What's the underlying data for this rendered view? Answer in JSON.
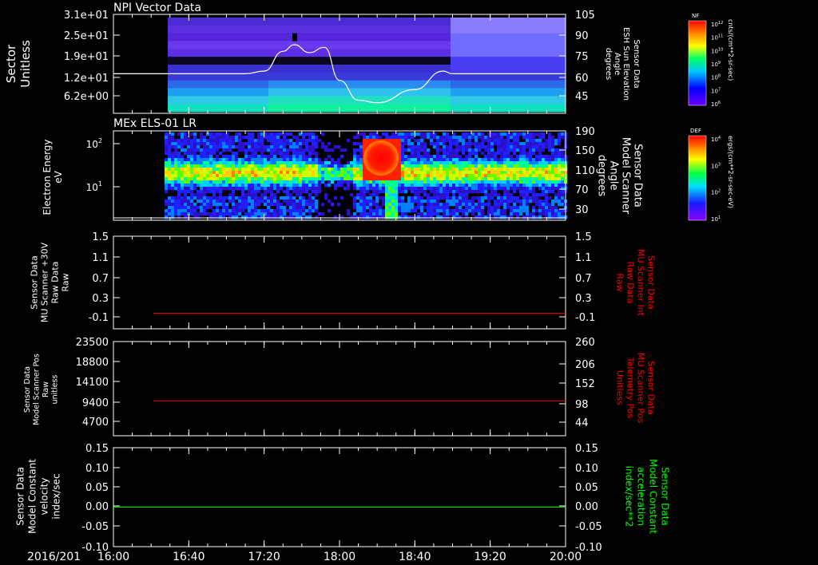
{
  "colors": {
    "background": "#000000",
    "axes": "#ffffff",
    "series_white": "#ffffff",
    "series_red": "#ff0000",
    "series_green": "#00ff00"
  },
  "time_axis": {
    "date_label": "2016/201",
    "ticks": [
      "16:00",
      "16:40",
      "17:20",
      "18:00",
      "18:40",
      "19:20",
      "20:00"
    ]
  },
  "chart_data": [
    {
      "type": "heatmap",
      "title": "NPI Vector Data",
      "ylabel": [
        "Sector",
        "Unitless"
      ],
      "y_ticks": [
        "3.1e+01",
        "2.5e+01",
        "1.9e+01",
        "1.2e+01",
        "6.2e+00"
      ],
      "y2label": [
        "ESH Sun Elevation",
        "Angle",
        "degrees"
      ],
      "y2label_side": [
        "Sensor Data"
      ],
      "y2_ticks": [
        "105",
        "90",
        "75",
        "60",
        "45"
      ],
      "y2lim": [
        30,
        105
      ],
      "line_series": {
        "x": [
          "16:00",
          "17:10",
          "17:20",
          "17:30",
          "17:36",
          "17:44",
          "17:52",
          "18:00",
          "18:10",
          "18:20",
          "18:40",
          "18:55",
          "19:00",
          "19:20",
          "20:00"
        ],
        "values": [
          60,
          60,
          62,
          77,
          82,
          76,
          80,
          55,
          40,
          38,
          48,
          62,
          60,
          60,
          60
        ]
      },
      "colorbar": {
        "label": "NF",
        "unit": "cnts/(cm**2-sr-sec)",
        "ticks": [
          "10^12",
          "10^11",
          "10^10",
          "10^9",
          "10^8",
          "10^7",
          "10^6"
        ]
      }
    },
    {
      "type": "heatmap",
      "title": "MEx ELS-01 LR",
      "ylabel": [
        "Electron Energy",
        "eV"
      ],
      "y_ticks": [
        "10^2",
        "10^1"
      ],
      "y2label": [
        "Sensor Data",
        "Model Scanner",
        "Angle",
        "degrees"
      ],
      "y2_ticks": [
        "190",
        "150",
        "110",
        "70",
        "30"
      ],
      "colorbar": {
        "label": "DEF",
        "unit": "ergs/(cm**2-sr-sec-eV)",
        "ticks": [
          "10^4",
          "10^3",
          "10^2",
          "10^1"
        ]
      }
    },
    {
      "type": "line",
      "ylabel": [
        "Sensor Data",
        "MU Scanner +30V",
        "Raw Data",
        "Raw"
      ],
      "y_ticks": [
        "1.5",
        "1.1",
        "0.7",
        "0.3",
        "-0.1"
      ],
      "y2label": [
        "Sensor Data",
        "MU Scanner Int",
        "Raw Data",
        "Raw"
      ],
      "y2_ticks": [
        "1.5",
        "1.1",
        "0.7",
        "0.3",
        "-0.1"
      ],
      "ylim": [
        -0.3,
        1.5
      ],
      "series": [
        {
          "x": [
            "16:40",
            "20:00"
          ],
          "values": [
            0.0,
            0.0
          ]
        }
      ]
    },
    {
      "type": "line",
      "ylabel": [
        "Sensor Data",
        "Model Scanner Pos",
        "Raw",
        "unitless"
      ],
      "y_ticks": [
        "23500",
        "18800",
        "14100",
        "9400",
        "4700"
      ],
      "y2label": [
        "Sensor Data",
        "MU Scanner Pos",
        "Telemetry Pos",
        "Unitless"
      ],
      "y2_ticks": [
        "260",
        "206",
        "152",
        "98",
        "44"
      ],
      "y2lim": [
        -10,
        260
      ],
      "series": [
        {
          "x": [
            "16:40",
            "20:00"
          ],
          "values": [
            90,
            90
          ]
        }
      ]
    },
    {
      "type": "line",
      "ylabel": [
        "Sensor Data",
        "Model Constant",
        "velocity",
        "index/sec"
      ],
      "y_ticks": [
        "0.15",
        "0.10",
        "0.05",
        "0.00",
        "-0.05",
        "-0.10"
      ],
      "y2label": [
        "Sensor Data",
        "Model Constant",
        "acceleration",
        "index/sec**2"
      ],
      "y2_ticks": [
        "0.15",
        "0.10",
        "0.05",
        "0.00",
        "-0.05",
        "-0.10"
      ],
      "ylim": [
        -0.1,
        0.15
      ],
      "series": [
        {
          "x": [
            "16:00",
            "20:00"
          ],
          "values": [
            0.0,
            0.0
          ]
        }
      ]
    }
  ]
}
